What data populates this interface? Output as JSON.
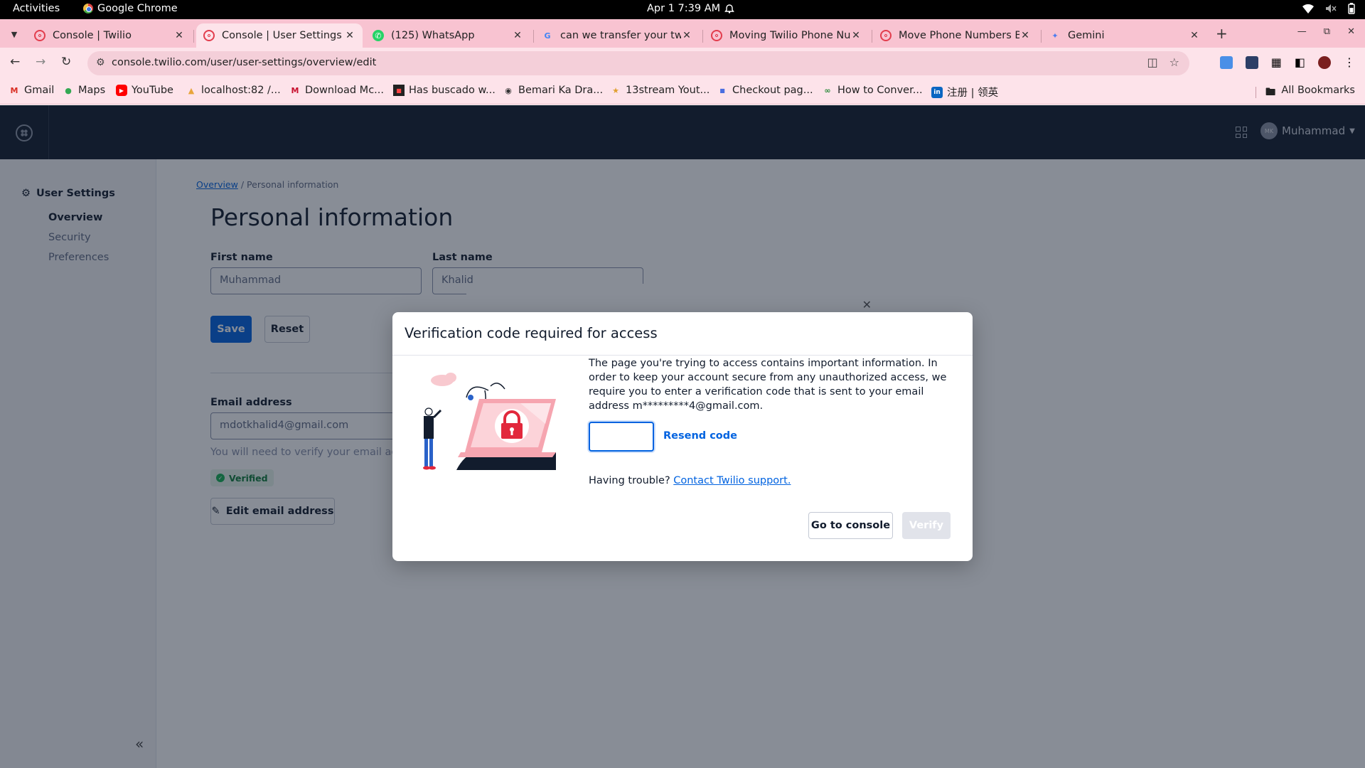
{
  "system": {
    "activities": "Activities",
    "app_name": "Google Chrome",
    "clock": "Apr 1  7:39 AM"
  },
  "tabs": [
    {
      "label": "Console | Twilio",
      "icon": "twilio-icon",
      "active": false
    },
    {
      "label": "Console | User Settings",
      "icon": "twilio-icon",
      "active": true
    },
    {
      "label": "(125) WhatsApp",
      "icon": "whatsapp-icon",
      "active": false
    },
    {
      "label": "can we transfer your twi",
      "icon": "google-icon",
      "active": false
    },
    {
      "label": "Moving Twilio Phone Nu",
      "icon": "twilio-icon",
      "active": false
    },
    {
      "label": "Move Phone Numbers Be",
      "icon": "twilio-icon",
      "active": false
    },
    {
      "label": "Gemini",
      "icon": "gemini-icon",
      "active": false
    }
  ],
  "address_bar": {
    "url": "console.twilio.com/user/user-settings/overview/edit"
  },
  "bookmarks": [
    {
      "label": "Gmail",
      "icon": "gmail-icon"
    },
    {
      "label": "Maps",
      "icon": "maps-icon"
    },
    {
      "label": "YouTube",
      "icon": "youtube-icon"
    },
    {
      "label": "localhost:82 /...",
      "icon": "folder-icon"
    },
    {
      "label": "Download Mc...",
      "icon": "mcafee-icon"
    },
    {
      "label": "Has buscado w...",
      "icon": "site-icon"
    },
    {
      "label": "Bemari Ka Dra...",
      "icon": "site-icon"
    },
    {
      "label": "13stream Yout...",
      "icon": "site-icon"
    },
    {
      "label": "Checkout pag...",
      "icon": "site-icon"
    },
    {
      "label": "How to Conver...",
      "icon": "site-icon"
    },
    {
      "label": "注册 | 领英",
      "icon": "linkedin-icon"
    }
  ],
  "all_bookmarks": "All Bookmarks",
  "twilio": {
    "user_initials": "MK",
    "user_name": "Muhammad",
    "sidebar": {
      "section": "User Settings",
      "items": [
        "Overview",
        "Security",
        "Preferences"
      ]
    },
    "breadcrumb": {
      "link": "Overview",
      "current": "Personal information"
    },
    "page_title": "Personal information",
    "first_name_label": "First name",
    "first_name_value": "Muhammad",
    "last_name_label": "Last name",
    "last_name_value": "Khalid",
    "save_label": "Save",
    "reset_label": "Reset",
    "email_label": "Email address",
    "email_value": "mdotkhalid4@gmail.com",
    "email_help": "You will need to verify your email again",
    "verified_label": "Verified",
    "edit_email_label": "Edit email address"
  },
  "modal": {
    "title": "Verification code required for access",
    "body": "The page you're trying to access contains important information. In order to keep your account secure from any unauthorized access, we require you to enter a verification code that is sent to your email address m*********4@gmail.com.",
    "code_value": "",
    "resend_label": "Resend code",
    "trouble_text": "Having trouble?",
    "support_link": "Contact Twilio support.",
    "console_button": "Go to console",
    "verify_button": "Verify"
  },
  "colors": {
    "twilio_blue": "#0263e0",
    "tab_strip": "#f8c3d1",
    "toolbar": "#fde3ea"
  }
}
